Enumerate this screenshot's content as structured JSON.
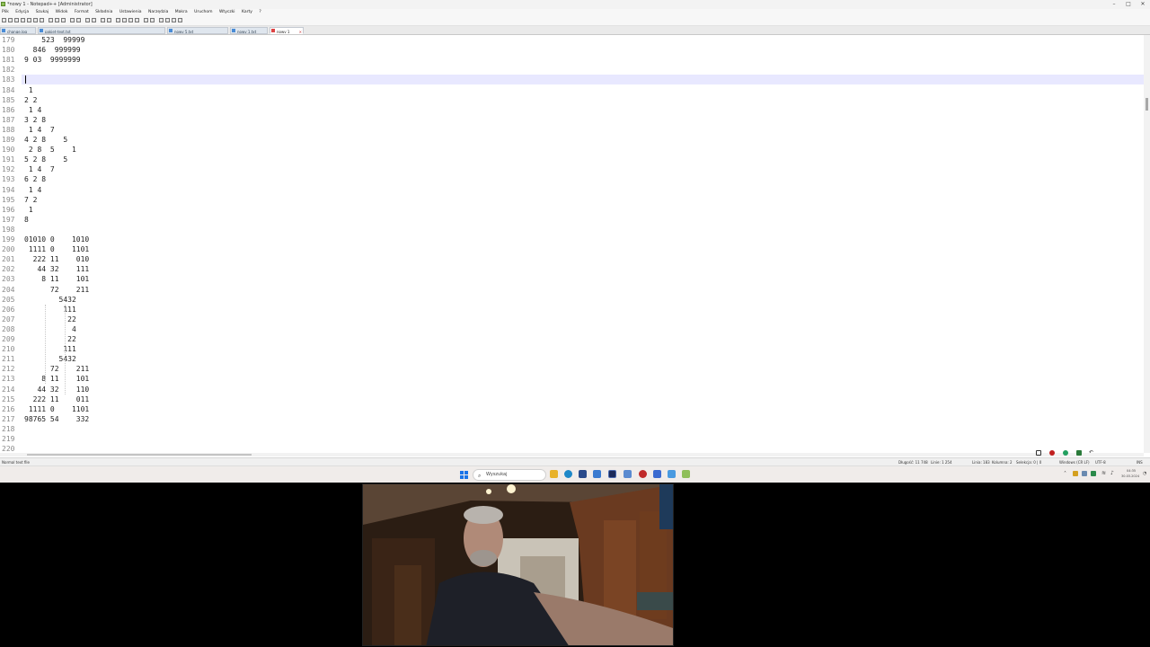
{
  "window": {
    "title": "*nowy 1 - Notepad++ [Administrator]",
    "controls": [
      "–",
      "□",
      "✕"
    ]
  },
  "menu": [
    "Plik",
    "Edycja",
    "Szukaj",
    "Widok",
    "Format",
    "Składnia",
    "Ustawienia",
    "Narzędzia",
    "Makra",
    "Uruchom",
    "Wtyczki",
    "Karty",
    "?"
  ],
  "tabs": [
    {
      "label": "change.log",
      "active": false
    },
    {
      "label": "pakiet-text.txt",
      "active": false
    },
    {
      "label": "nowy 5.txt",
      "active": false
    },
    {
      "label": "nowy 1.txt",
      "active": false
    },
    {
      "label": "nowy 1",
      "active": true
    }
  ],
  "editor": {
    "lines": [
      {
        "n": "179",
        "text": "    523  99999"
      },
      {
        "n": "180",
        "text": "  846  999999"
      },
      {
        "n": "181",
        "text": "9 03  9999999"
      },
      {
        "n": "182",
        "text": ""
      },
      {
        "n": "183",
        "text": ""
      },
      {
        "n": "184",
        "text": " 1"
      },
      {
        "n": "185",
        "text": "2 2"
      },
      {
        "n": "186",
        "text": " 1 4"
      },
      {
        "n": "187",
        "text": "3 2 8"
      },
      {
        "n": "188",
        "text": " 1 4  7"
      },
      {
        "n": "189",
        "text": "4 2 8    5"
      },
      {
        "n": "190",
        "text": " 2 8  5    1"
      },
      {
        "n": "191",
        "text": "5 2 8    5"
      },
      {
        "n": "192",
        "text": " 1 4  7"
      },
      {
        "n": "193",
        "text": "6 2 8"
      },
      {
        "n": "194",
        "text": " 1 4"
      },
      {
        "n": "195",
        "text": "7 2"
      },
      {
        "n": "196",
        "text": " 1"
      },
      {
        "n": "197",
        "text": "8"
      },
      {
        "n": "198",
        "text": ""
      },
      {
        "n": "199",
        "text": "01010 0    1010"
      },
      {
        "n": "200",
        "text": " 1111 0    1101"
      },
      {
        "n": "201",
        "text": "  222 11    010"
      },
      {
        "n": "202",
        "text": "   44 32    111"
      },
      {
        "n": "203",
        "text": "    8 11    101"
      },
      {
        "n": "204",
        "text": "      72    211"
      },
      {
        "n": "205",
        "text": "        5432"
      },
      {
        "n": "206",
        "text": "         111"
      },
      {
        "n": "207",
        "text": "          22"
      },
      {
        "n": "208",
        "text": "           4"
      },
      {
        "n": "209",
        "text": "          22"
      },
      {
        "n": "210",
        "text": "         111"
      },
      {
        "n": "211",
        "text": "        5432"
      },
      {
        "n": "212",
        "text": "      72    211"
      },
      {
        "n": "213",
        "text": "    8 11    101"
      },
      {
        "n": "214",
        "text": "   44 32    110"
      },
      {
        "n": "215",
        "text": "  222 11    011"
      },
      {
        "n": "216",
        "text": " 1111 0    1101"
      },
      {
        "n": "217",
        "text": "98765 54    332"
      },
      {
        "n": "218",
        "text": ""
      },
      {
        "n": "219",
        "text": ""
      },
      {
        "n": "220",
        "text": ""
      }
    ],
    "current_line": "183"
  },
  "status": {
    "file_type": "Normal text file",
    "length": "Długość: 11 748",
    "lines": "Linie: 1 254",
    "line": "Linia: 183",
    "column": "Kolumna: 2",
    "selection": "Selekcja: 0 | 0",
    "eol": "Windows (CR LF)",
    "encoding": "UTF-8",
    "mode": "INS"
  },
  "taskbar": {
    "search_placeholder": "Wyszukaj",
    "time": "04:35",
    "date": "30.03.2024"
  },
  "colors": {
    "current_line": "#e8e8ff",
    "gutter_text": "#8a8a8a",
    "active_tab_icon": "#dd4444",
    "windows_blue": "#1a73e8"
  }
}
